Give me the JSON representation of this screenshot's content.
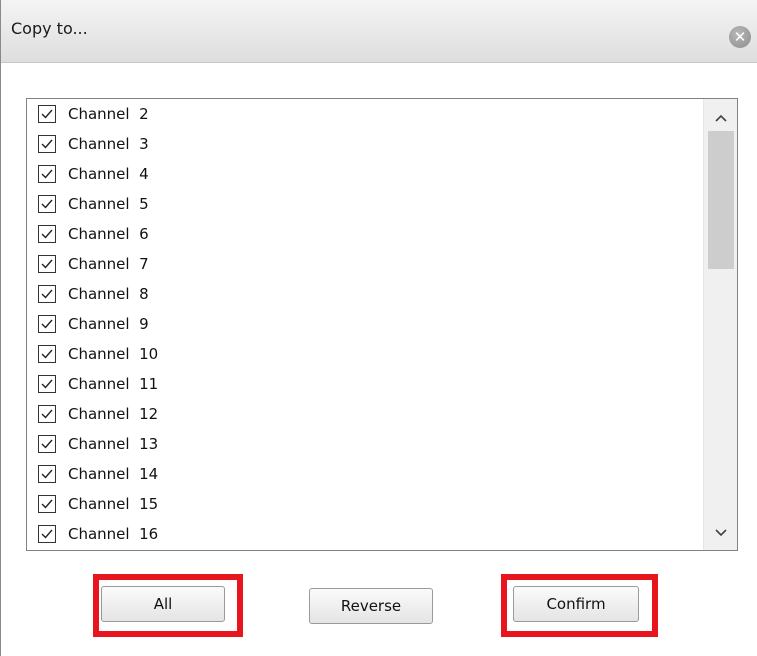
{
  "dialog": {
    "title": "Copy to...",
    "close_icon": "close-circle-icon"
  },
  "channels": [
    {
      "label": "Channel  2",
      "checked": true
    },
    {
      "label": "Channel  3",
      "checked": true
    },
    {
      "label": "Channel  4",
      "checked": true
    },
    {
      "label": "Channel  5",
      "checked": true
    },
    {
      "label": "Channel  6",
      "checked": true
    },
    {
      "label": "Channel  7",
      "checked": true
    },
    {
      "label": "Channel  8",
      "checked": true
    },
    {
      "label": "Channel  9",
      "checked": true
    },
    {
      "label": "Channel  10",
      "checked": true
    },
    {
      "label": "Channel  11",
      "checked": true
    },
    {
      "label": "Channel  12",
      "checked": true
    },
    {
      "label": "Channel  13",
      "checked": true
    },
    {
      "label": "Channel  14",
      "checked": true
    },
    {
      "label": "Channel  15",
      "checked": true
    },
    {
      "label": "Channel  16",
      "checked": true
    }
  ],
  "scrollbar": {
    "up_glyph": "^",
    "down_glyph": "v"
  },
  "buttons": {
    "all": "All",
    "reverse": "Reverse",
    "confirm": "Confirm"
  },
  "colors": {
    "highlight": "#e8141e"
  }
}
